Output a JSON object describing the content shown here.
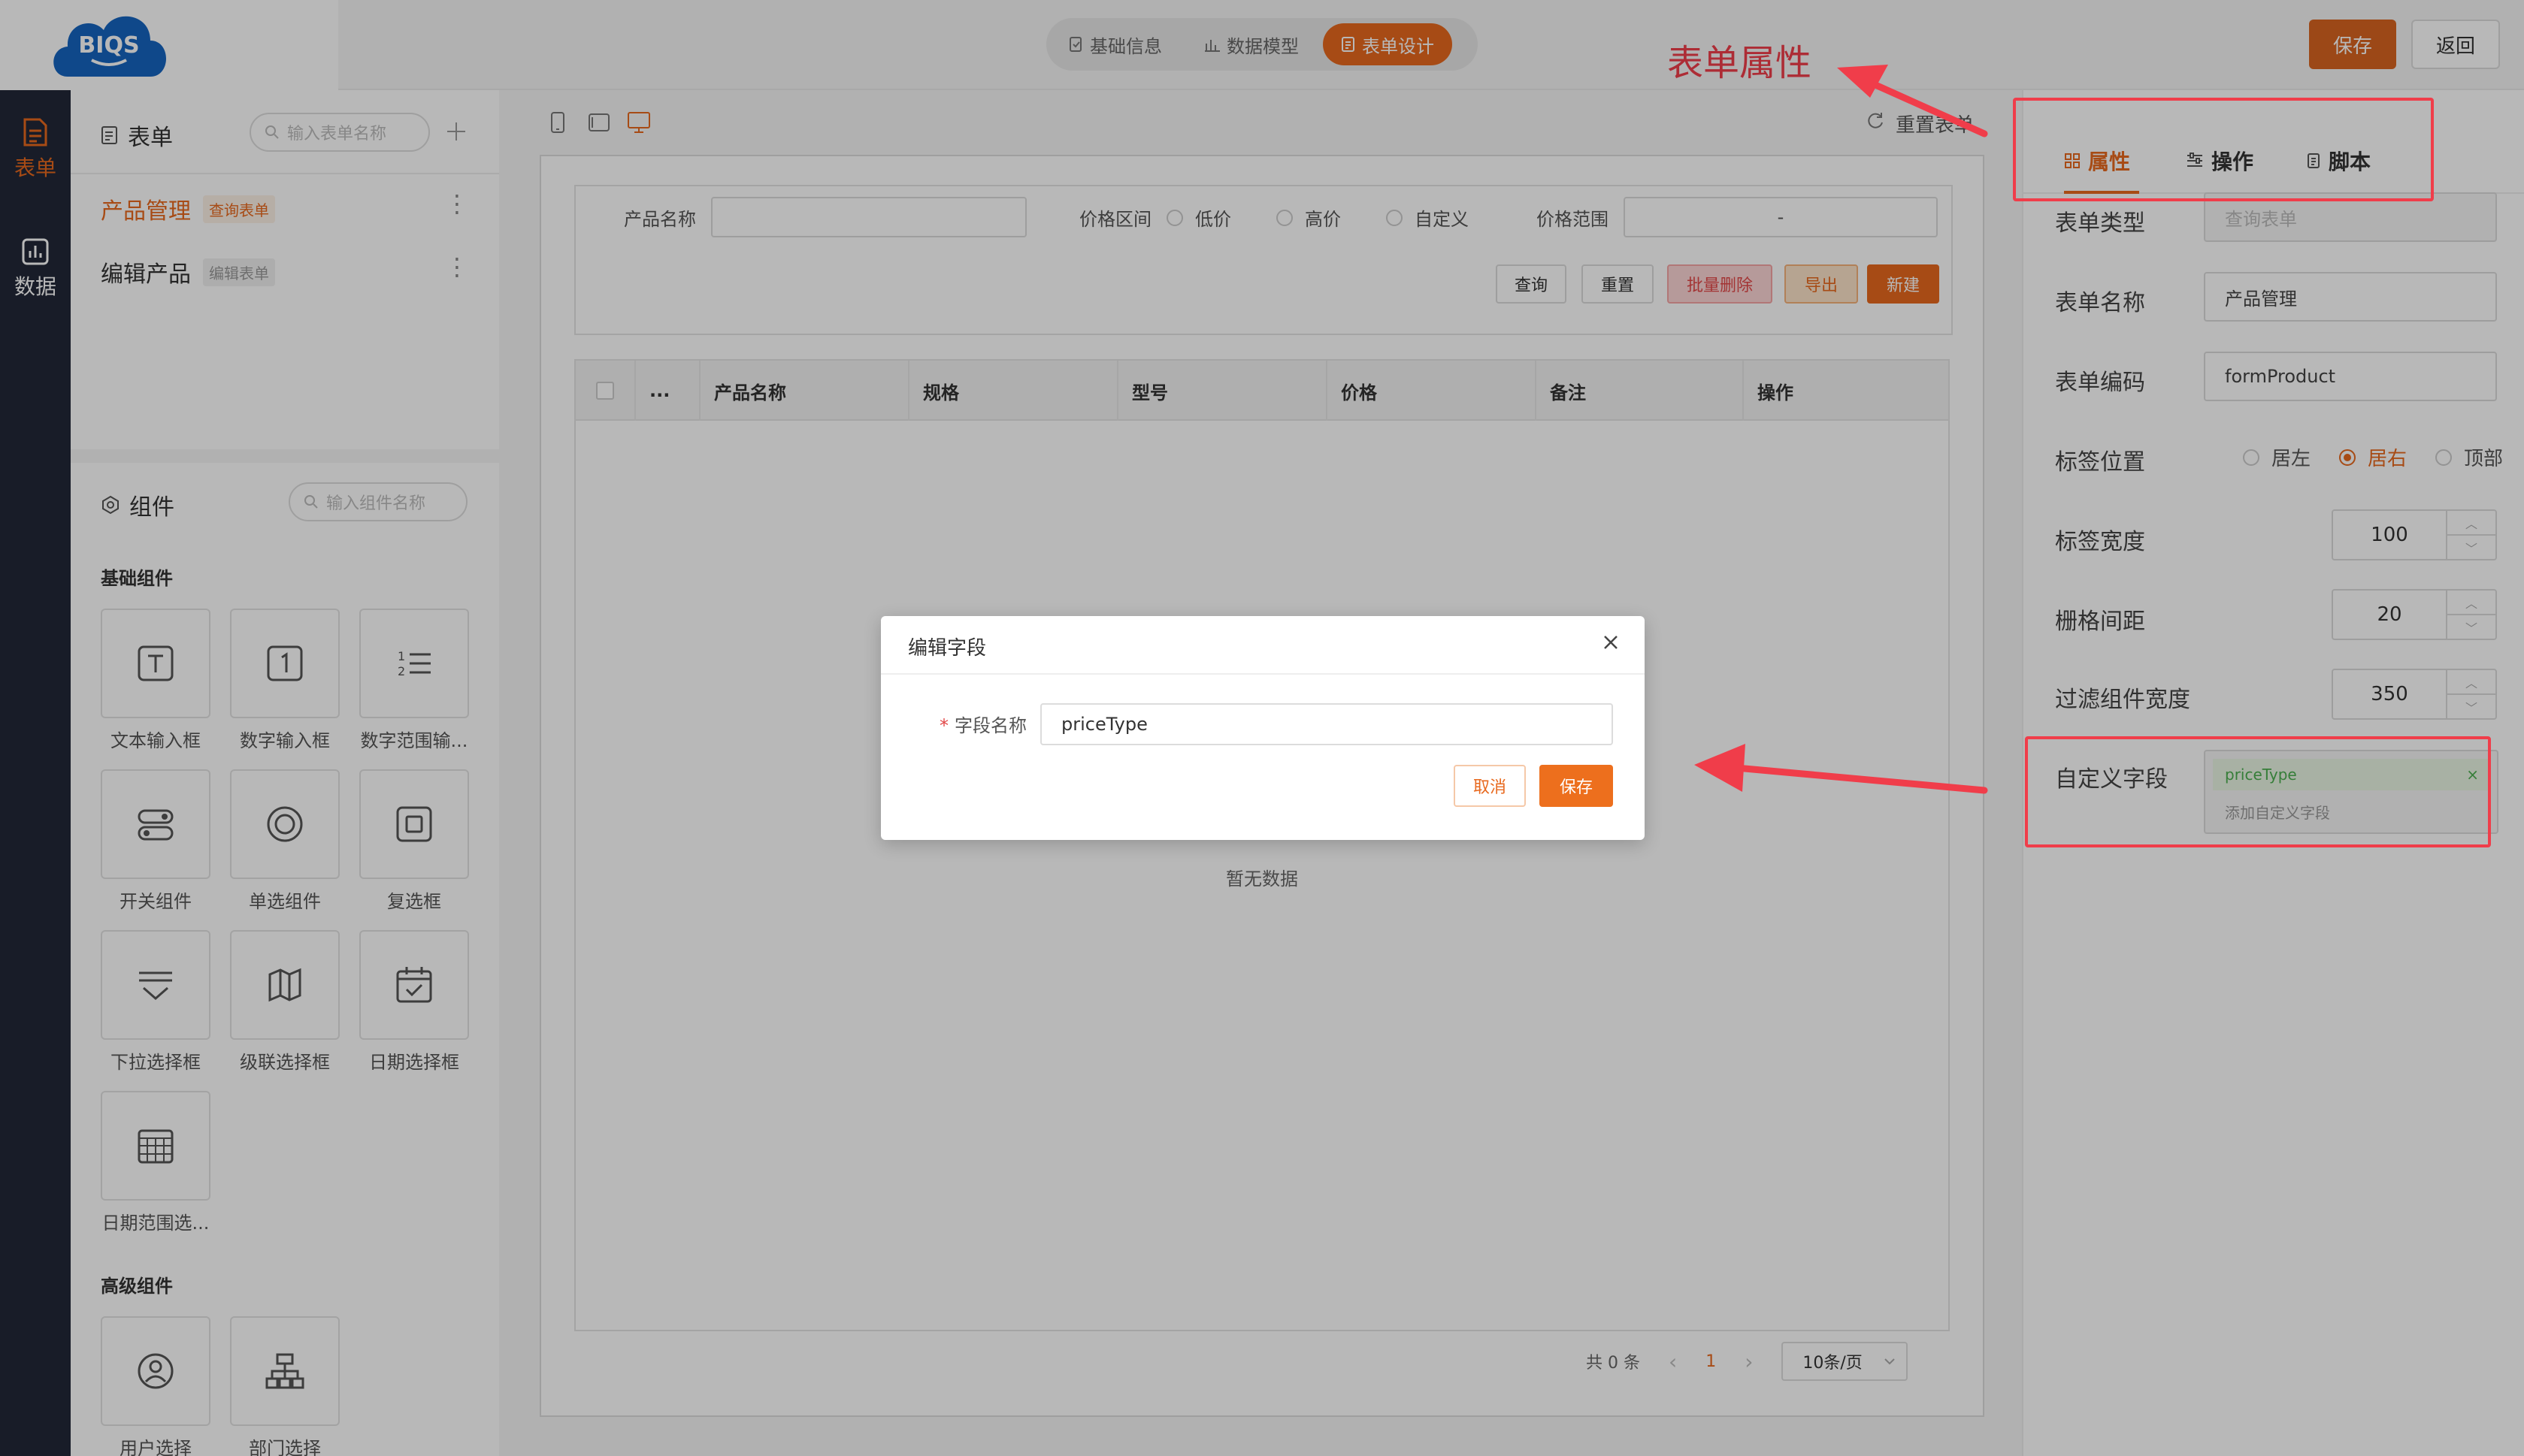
{
  "logo": {
    "text": "BIQS"
  },
  "header": {
    "steps": [
      {
        "label": "基础信息",
        "icon": "document-check-icon",
        "active": false
      },
      {
        "label": "数据模型",
        "icon": "bar-chart-icon",
        "active": false
      },
      {
        "label": "表单设计",
        "icon": "form-icon",
        "active": true
      }
    ],
    "save_label": "保存",
    "back_label": "返回"
  },
  "annotation": {
    "title": "表单属性",
    "color": "#f03d4a"
  },
  "rail": {
    "items": [
      {
        "label": "表单",
        "icon": "form-icon",
        "active": true
      },
      {
        "label": "数据",
        "icon": "chart-icon",
        "active": false
      }
    ]
  },
  "forms_panel": {
    "title": "表单",
    "search_placeholder": "输入表单名称",
    "items": [
      {
        "name": "产品管理",
        "tag": "查询表单",
        "active": true
      },
      {
        "name": "编辑产品",
        "tag": "编辑表单",
        "active": false
      }
    ]
  },
  "components_panel": {
    "title": "组件",
    "search_placeholder": "输入组件名称",
    "basic_label": "基础组件",
    "basic": [
      {
        "label": "文本输入框",
        "icon": "text-input-icon"
      },
      {
        "label": "数字输入框",
        "icon": "number-input-icon"
      },
      {
        "label": "数字范围输...",
        "icon": "number-range-icon"
      },
      {
        "label": "开关组件",
        "icon": "switch-icon"
      },
      {
        "label": "单选组件",
        "icon": "radio-icon"
      },
      {
        "label": "复选框",
        "icon": "checkbox-icon"
      },
      {
        "label": "下拉选择框",
        "icon": "dropdown-icon"
      },
      {
        "label": "级联选择框",
        "icon": "cascader-icon"
      },
      {
        "label": "日期选择框",
        "icon": "date-picker-icon"
      },
      {
        "label": "日期范围选...",
        "icon": "date-range-icon"
      }
    ],
    "advanced_label": "高级组件",
    "advanced": [
      {
        "label": "用户选择",
        "icon": "user-icon"
      },
      {
        "label": "部门选择",
        "icon": "org-chart-icon"
      }
    ]
  },
  "canvas": {
    "reset_label": "重置表单",
    "filters": {
      "product_name_label": "产品名称",
      "price_interval_label": "价格区间",
      "price_options": [
        "低价",
        "高价",
        "自定义"
      ],
      "price_range_label": "价格范围",
      "range_separator": "-"
    },
    "buttons": {
      "query": "查询",
      "reset": "重置",
      "batch_delete": "批量删除",
      "export": "导出",
      "create": "新建"
    },
    "table": {
      "columns": [
        "...",
        "产品名称",
        "规格",
        "型号",
        "价格",
        "备注",
        "操作"
      ],
      "empty": "暂无数据"
    },
    "pager": {
      "total": "共 0 条",
      "prev": "‹",
      "page": "1",
      "next": "›",
      "size": "10条/页"
    }
  },
  "right_panel": {
    "tabs": [
      {
        "label": "属性",
        "icon": "grid-icon",
        "active": true
      },
      {
        "label": "操作",
        "icon": "sliders-icon",
        "active": false
      },
      {
        "label": "脚本",
        "icon": "script-icon",
        "active": false
      }
    ],
    "props": {
      "form_type_label": "表单类型",
      "form_type_placeholder": "查询表单",
      "form_name_label": "表单名称",
      "form_name_value": "产品管理",
      "form_code_label": "表单编码",
      "form_code_value": "formProduct",
      "label_position_label": "标签位置",
      "label_position_options": [
        "居左",
        "居右",
        "顶部"
      ],
      "label_position_selected": "居右",
      "label_width_label": "标签宽度",
      "label_width_value": "100",
      "grid_gap_label": "栅格间距",
      "grid_gap_value": "20",
      "filter_width_label": "过滤组件宽度",
      "filter_width_value": "350",
      "custom_field_label": "自定义字段",
      "custom_field_tag": "priceType",
      "custom_field_remove": "×",
      "custom_field_add": "添加自定义字段"
    }
  },
  "modal": {
    "title": "编辑字段",
    "required_mark": "*",
    "field_label": "字段名称",
    "field_value": "priceType",
    "cancel_label": "取消",
    "save_label": "保存"
  },
  "colors": {
    "accent": "#e8691e",
    "rail": "#222838",
    "annotation": "#f03d4a"
  }
}
